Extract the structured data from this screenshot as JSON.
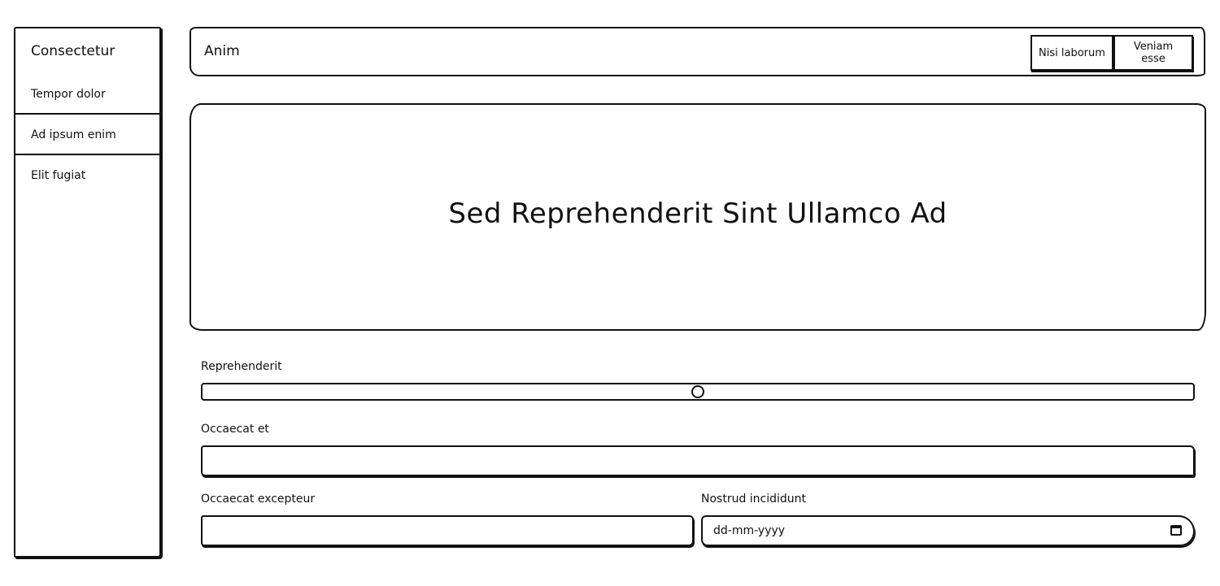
{
  "sidebar": {
    "title": "Consectetur",
    "items": [
      {
        "label": "Tempor dolor"
      },
      {
        "label": "Ad ipsum enim"
      },
      {
        "label": "Elit fugiat"
      }
    ]
  },
  "topbar": {
    "title": "Anim",
    "buttons": [
      {
        "label": "Nisi laborum"
      },
      {
        "label": "Veniam esse"
      }
    ]
  },
  "hero": {
    "title": "Sed Reprehenderit Sint Ullamco Ad"
  },
  "form": {
    "slider": {
      "label": "Reprehenderit",
      "value_percent": 50
    },
    "field1": {
      "label": "Occaecat et",
      "value": ""
    },
    "field2": {
      "label": "Occaecat excepteur",
      "value": ""
    },
    "date": {
      "label": "Nostrud incididunt",
      "placeholder": "dd-mm-yyyy",
      "icon": "calendar-icon"
    }
  }
}
